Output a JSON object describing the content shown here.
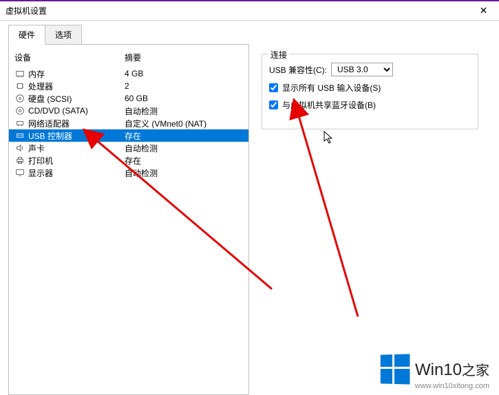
{
  "window": {
    "title": "虚拟机设置"
  },
  "tabs": {
    "hardware": "硬件",
    "options": "选项"
  },
  "device_list": {
    "header_device": "设备",
    "header_summary": "摘要",
    "items": [
      {
        "icon": "memory-icon",
        "name": "内存",
        "summary": "4 GB"
      },
      {
        "icon": "cpu-icon",
        "name": "处理器",
        "summary": "2"
      },
      {
        "icon": "disk-icon",
        "name": "硬盘 (SCSI)",
        "summary": "60 GB"
      },
      {
        "icon": "cd-icon",
        "name": "CD/DVD (SATA)",
        "summary": "自动检测"
      },
      {
        "icon": "network-icon",
        "name": "网络适配器",
        "summary": "自定义 (VMnet0 (NAT)"
      },
      {
        "icon": "usb-icon",
        "name": "USB 控制器",
        "summary": "存在",
        "selected": true
      },
      {
        "icon": "sound-icon",
        "name": "声卡",
        "summary": "自动检测"
      },
      {
        "icon": "printer-icon",
        "name": "打印机",
        "summary": "存在"
      },
      {
        "icon": "display-icon",
        "name": "显示器",
        "summary": "自动检测"
      }
    ]
  },
  "connection": {
    "group_title": "连接",
    "compat_label": "USB 兼容性(C):",
    "compat_value": "USB 3.0",
    "show_all_label": "显示所有 USB 输入设备(S)",
    "show_all_checked": true,
    "share_bt_label": "与虚拟机共享蓝牙设备(B)",
    "share_bt_checked": true
  },
  "watermark": {
    "brand": "Win10",
    "suffix": "之家",
    "url": "www.win10xitong.com"
  }
}
